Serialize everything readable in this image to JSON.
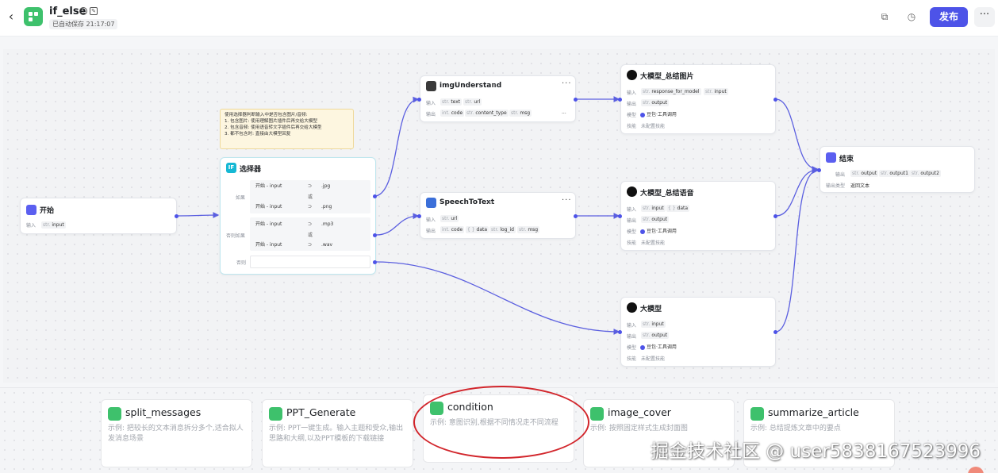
{
  "header": {
    "back": "‹",
    "title": "if_else",
    "info": "i",
    "edit": "✎",
    "autosave": "已自动保存 21:17:07",
    "copy_icon": "⧉",
    "history_icon": "◷",
    "publish": "发布",
    "more": "···"
  },
  "note": {
    "lines": [
      "使用选择器判断输入中是否包含图片/音频:",
      "1. 包含图片: 使用理解图片插件后再交给大模型",
      "2. 包含音频: 使用语音转文字插件后再交给大模型",
      "3. 都不包含时: 直接由大模型回复"
    ]
  },
  "labels": {
    "input": "输入",
    "output": "输出",
    "model": "模型",
    "skill": "技能",
    "output_type": "输出类型",
    "or": "或",
    "more": "···",
    "verified": "⊡"
  },
  "nodes": {
    "start": {
      "title": "开始",
      "input_type": "str.",
      "input_name": "input"
    },
    "selector": {
      "title": "选择器",
      "icon": "IF",
      "branch_if": "如果",
      "branch_elif": "否则如果",
      "branch_else": "否则",
      "rows": [
        {
          "left": "开始 - input",
          "op": "⊃",
          "right": ".jpg"
        },
        {
          "left": "开始 - input",
          "op": "⊃",
          "right": ".png"
        },
        {
          "left": "开始 - input",
          "op": "⊃",
          "right": ".mp3"
        },
        {
          "left": "开始 - input",
          "op": "⊃",
          "right": ".wav"
        }
      ]
    },
    "img_understand": {
      "title": "imgUnderstand",
      "inputs": [
        {
          "t": "str.",
          "n": "text"
        },
        {
          "t": "str.",
          "n": "url"
        }
      ],
      "outputs": [
        {
          "t": "int.",
          "n": "code"
        },
        {
          "t": "str.",
          "n": "content_type"
        },
        {
          "t": "str.",
          "n": "msg"
        }
      ],
      "outputs_more": "..."
    },
    "speech_to_text": {
      "title": "SpeechToText",
      "inputs": [
        {
          "t": "str.",
          "n": "url"
        }
      ],
      "outputs": [
        {
          "t": "int.",
          "n": "code"
        },
        {
          "t": "{ }",
          "n": "data"
        },
        {
          "t": "str.",
          "n": "log_id"
        },
        {
          "t": "str.",
          "n": "msg"
        }
      ]
    },
    "llm_img": {
      "title": "大模型_总结图片",
      "inputs": [
        {
          "t": "str.",
          "n": "response_for_model"
        },
        {
          "t": "str.",
          "n": "input"
        }
      ],
      "output": {
        "t": "str.",
        "n": "output"
      },
      "model": "豆包·工具调用",
      "skill": "未配置技能"
    },
    "llm_audio": {
      "title": "大模型_总结语音",
      "inputs": [
        {
          "t": "str.",
          "n": "input"
        },
        {
          "t": "{ }",
          "n": "data"
        }
      ],
      "output": {
        "t": "str.",
        "n": "output"
      },
      "model": "豆包·工具调用",
      "skill": "未配置技能"
    },
    "llm": {
      "title": "大模型",
      "input": {
        "t": "str.",
        "n": "input"
      },
      "output": {
        "t": "str.",
        "n": "output"
      },
      "model": "豆包·工具调用",
      "skill": "未配置技能"
    },
    "end": {
      "title": "结束",
      "outputs": [
        {
          "t": "str.",
          "n": "output"
        },
        {
          "t": "str.",
          "n": "output1"
        },
        {
          "t": "str.",
          "n": "output2"
        }
      ],
      "output_type_value": "返回文本"
    }
  },
  "templates": [
    {
      "name": "split_messages",
      "desc": "示例: 把较长的文本消息拆分多个,适合拟人发消息场景"
    },
    {
      "name": "PPT_Generate",
      "desc": "示例: PPT一键生成。输入主题和受众,输出思路和大纲,以及PPT模板的下载链接"
    },
    {
      "name": "condition",
      "desc": "示例: 意图识别,根据不同情况走不同流程"
    },
    {
      "name": "image_cover",
      "desc": "示例: 按照固定样式生成封面图"
    },
    {
      "name": "summarize_article",
      "desc": "示例: 总结提炼文章中的要点"
    }
  ],
  "watermark": "掘金技术社区 @ user5838167523996",
  "colors": {
    "accent": "#4d53e8",
    "plugin_green": "#3ec16c",
    "highlight_red": "#d2262c",
    "edge": "#5b5fe0"
  }
}
